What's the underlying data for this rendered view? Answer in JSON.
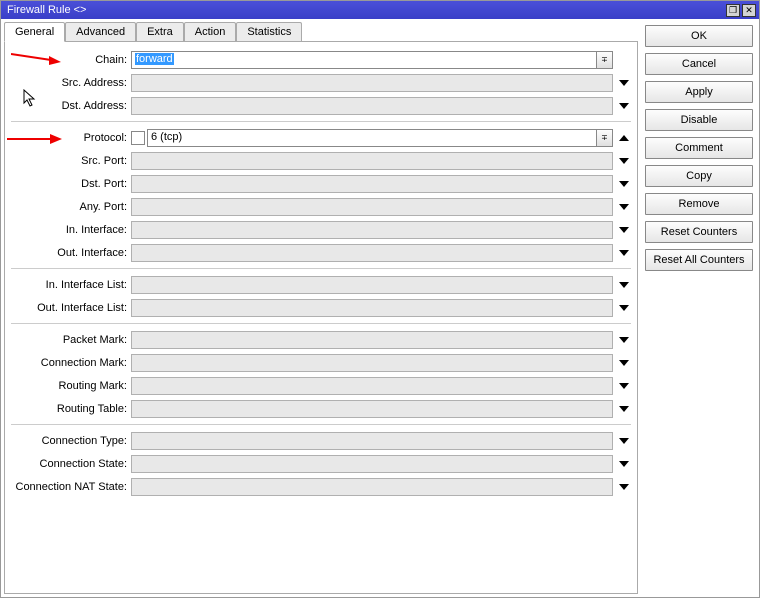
{
  "window": {
    "title": "Firewall Rule <>"
  },
  "tabs": {
    "general": "General",
    "advanced": "Advanced",
    "extra": "Extra",
    "action": "Action",
    "statistics": "Statistics"
  },
  "labels": {
    "chain": "Chain:",
    "src_address": "Src. Address:",
    "dst_address": "Dst. Address:",
    "protocol": "Protocol:",
    "src_port": "Src. Port:",
    "dst_port": "Dst. Port:",
    "any_port": "Any. Port:",
    "in_interface": "In. Interface:",
    "out_interface": "Out. Interface:",
    "in_interface_list": "In. Interface List:",
    "out_interface_list": "Out. Interface List:",
    "packet_mark": "Packet Mark:",
    "connection_mark": "Connection Mark:",
    "routing_mark": "Routing Mark:",
    "routing_table": "Routing Table:",
    "connection_type": "Connection Type:",
    "connection_state": "Connection State:",
    "connection_nat_state": "Connection NAT State:"
  },
  "values": {
    "chain": "forward",
    "protocol": "6 (tcp)"
  },
  "buttons": {
    "ok": "OK",
    "cancel": "Cancel",
    "apply": "Apply",
    "disable": "Disable",
    "comment": "Comment",
    "copy": "Copy",
    "remove": "Remove",
    "reset_counters": "Reset Counters",
    "reset_all_counters": "Reset All Counters"
  }
}
